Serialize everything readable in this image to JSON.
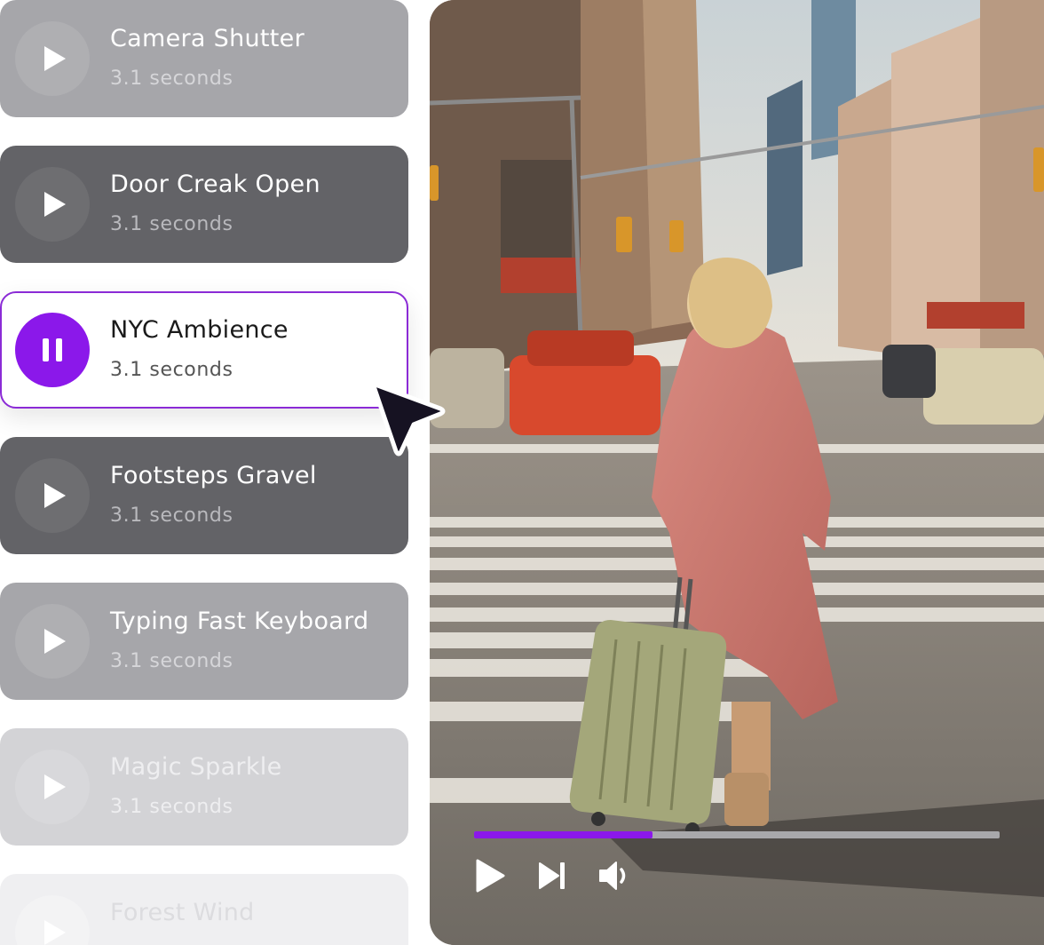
{
  "sounds": [
    {
      "title": "Camera Shutter",
      "duration": "3.1 seconds",
      "state": "play"
    },
    {
      "title": "Door Creak Open",
      "duration": "3.1 seconds",
      "state": "play"
    },
    {
      "title": "NYC Ambience",
      "duration": "3.1 seconds",
      "state": "pause",
      "active": true
    },
    {
      "title": "Footsteps Gravel",
      "duration": "3.1 seconds",
      "state": "play"
    },
    {
      "title": "Typing Fast Keyboard",
      "duration": "3.1 seconds",
      "state": "play"
    },
    {
      "title": "Magic Sparkle",
      "duration": "3.1 seconds",
      "state": "play"
    },
    {
      "title": "Forest Wind",
      "duration": "",
      "state": "play"
    }
  ],
  "player": {
    "progress": 0.34,
    "controls": [
      "play-icon",
      "skip-next-icon",
      "volume-icon"
    ]
  },
  "colors": {
    "accent": "#8b18ea",
    "active_border": "#8b2bd6"
  }
}
